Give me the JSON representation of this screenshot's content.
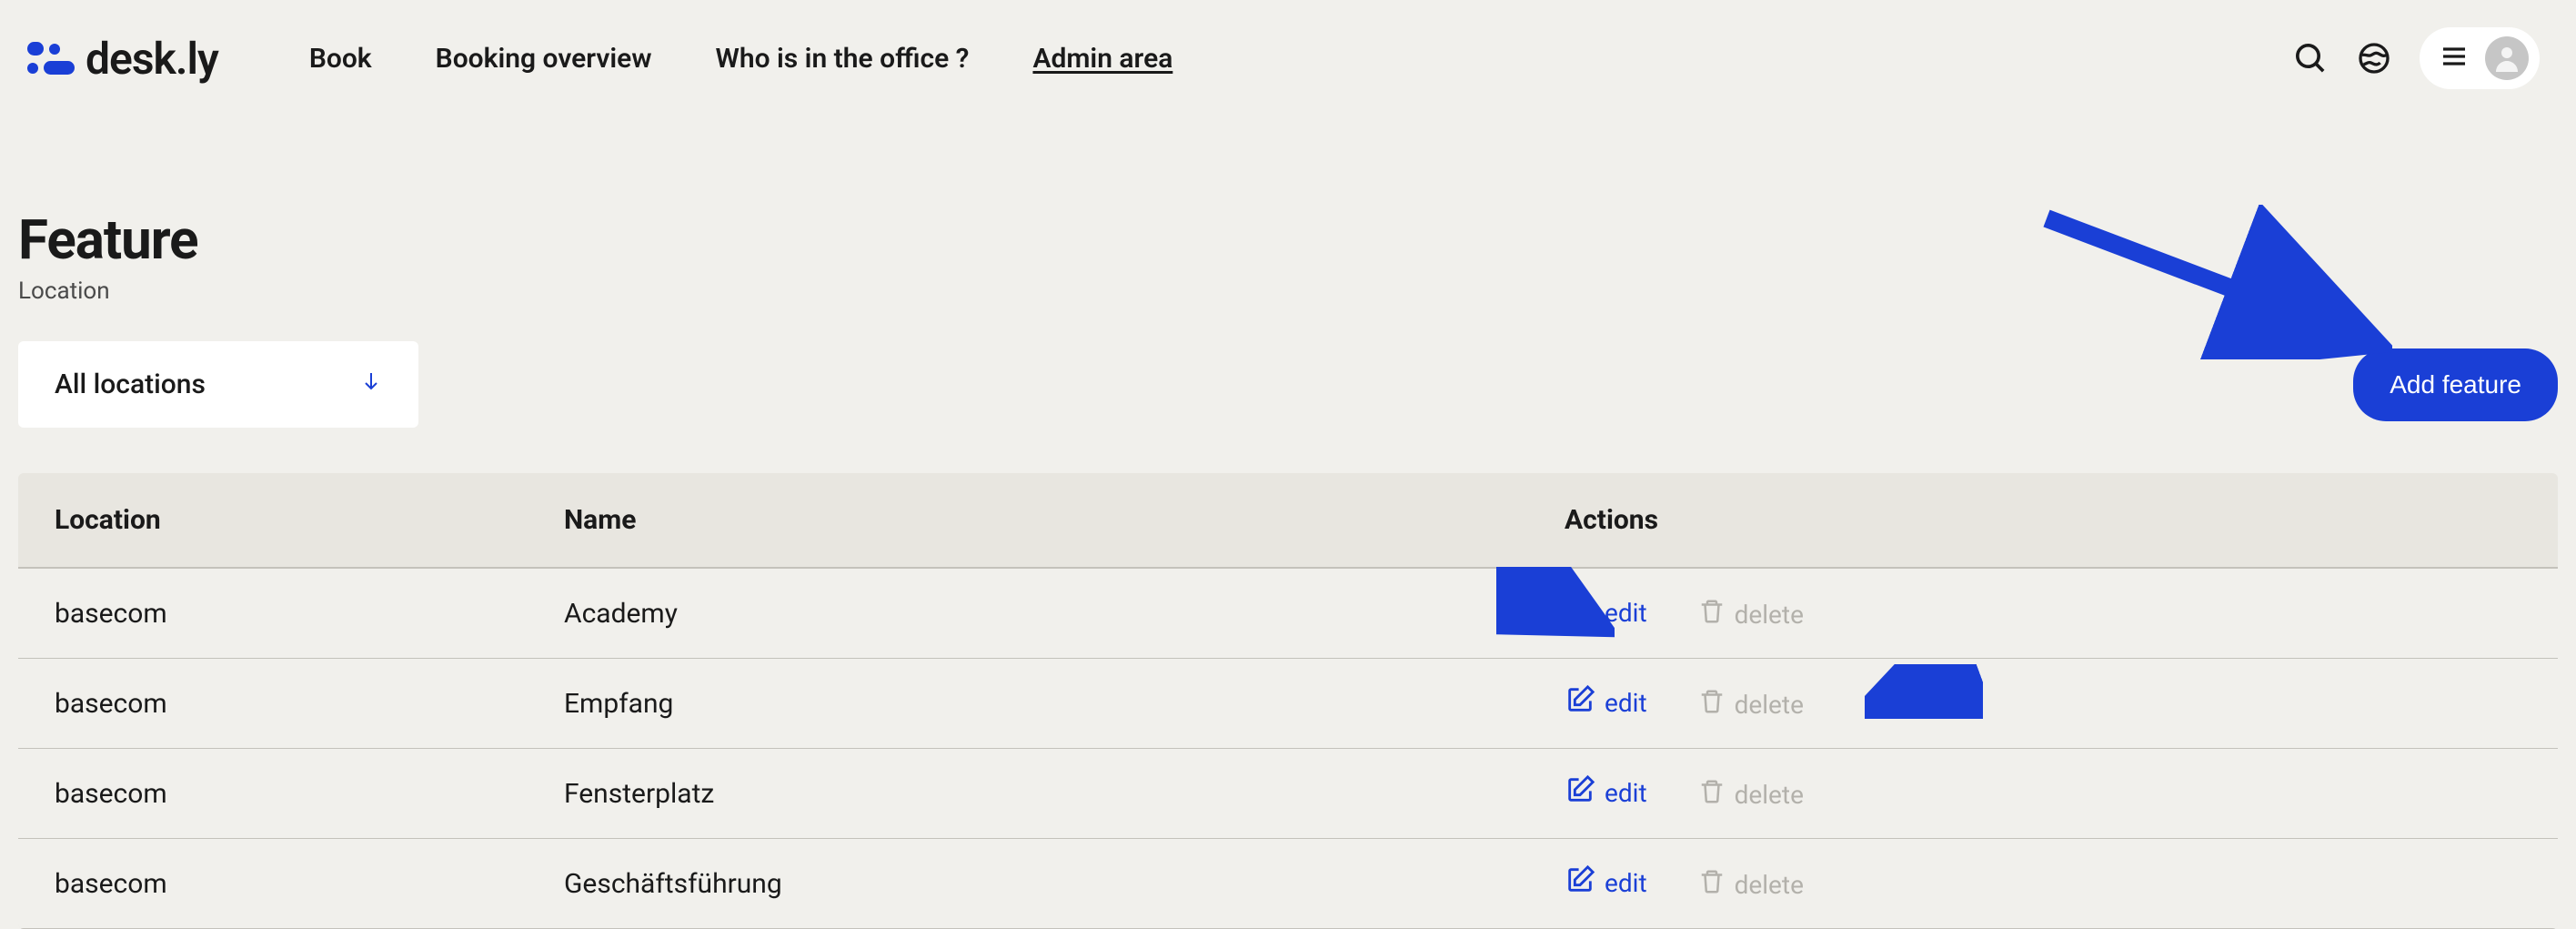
{
  "brand": "desk.ly",
  "nav": {
    "book": "Book",
    "overview": "Booking overview",
    "whois": "Who is in the office ?",
    "admin": "Admin area"
  },
  "page": {
    "title": "Feature",
    "subtitle": "Location"
  },
  "filter": {
    "label": "All locations"
  },
  "buttons": {
    "add": "Add feature"
  },
  "table": {
    "headers": {
      "location": "Location",
      "name": "Name",
      "actions": "Actions"
    },
    "edit_label": "edit",
    "delete_label": "delete",
    "rows": [
      {
        "location": "basecom",
        "name": "Academy"
      },
      {
        "location": "basecom",
        "name": "Empfang"
      },
      {
        "location": "basecom",
        "name": "Fensterplatz"
      },
      {
        "location": "basecom",
        "name": "Geschäftsführung"
      }
    ]
  },
  "colors": {
    "accent": "#1a3fd6",
    "background": "#f1f0ec"
  }
}
